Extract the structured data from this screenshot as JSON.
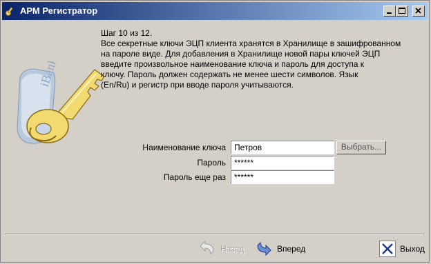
{
  "window": {
    "title": "АРМ Регистратор"
  },
  "instructions": {
    "step": "Шаг 10 из 12.",
    "lines": [
      "Все секретные ключи ЭЦП клиента хранятся в Хранилище в зашифрованном",
      "на пароле виде. Для добавления в Хранилище новой пары ключей ЭЦП",
      "введите произвольное наименование ключа и пароль для доступа к",
      "ключу. Пароль должен содержать не менее шести символов. Язык",
      "(En/Ru) и регистр при вводе пароля учитываются."
    ]
  },
  "illustration": {
    "logo_text": "iBank 2"
  },
  "form": {
    "key_name_label": "Наименование ключа",
    "key_name_value": "Петров",
    "choose_button": "Выбрать...",
    "password_label": "Пароль",
    "password_value": "******",
    "password_repeat_label": "Пароль еще раз",
    "password_repeat_value": "******"
  },
  "footer": {
    "back_label": "Назад",
    "forward_label": "Вперед",
    "exit_label": "Выход"
  },
  "colors": {
    "title_start": "#0a246a",
    "title_end": "#a6caf0",
    "key_gold": "#f2d970",
    "window_bg": "#d4d0c8"
  }
}
